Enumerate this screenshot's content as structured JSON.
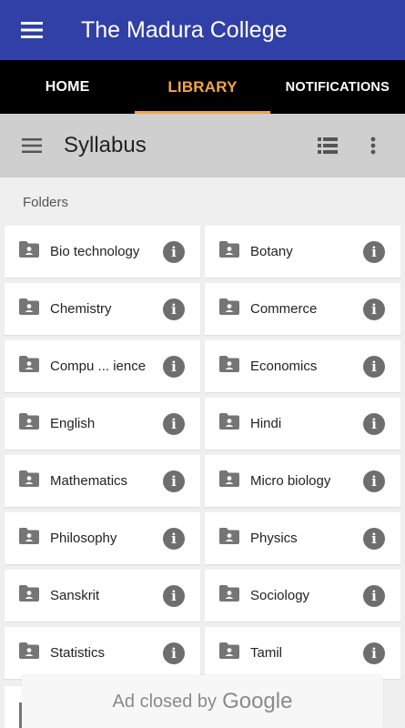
{
  "appbar": {
    "title": "The Madura College",
    "menu_icon": "hamburger-menu-icon"
  },
  "tabs": [
    {
      "label": "HOME",
      "active": false
    },
    {
      "label": "LIBRARY",
      "active": true
    },
    {
      "label": "NOTIFICATIONS",
      "active": false
    }
  ],
  "toolbar": {
    "title": "Syllabus",
    "menu_icon": "hamburger-menu-icon",
    "view_icon": "list-view-icon",
    "more_icon": "more-vert-icon"
  },
  "section": {
    "folders_label": "Folders"
  },
  "folders": [
    "Bio technology",
    "Botany",
    "Chemistry",
    "Commerce",
    "Compu ... ience",
    "Economics",
    "English",
    "Hindi",
    "Mathematics",
    "Micro biology",
    "Philosophy",
    "Physics",
    "Sanskrit",
    "Sociology",
    "Statistics",
    "Tamil"
  ],
  "info_glyph": "i",
  "ad": {
    "text": "Ad closed by",
    "brand": "Google"
  },
  "colors": {
    "appbar": "#3140a7",
    "tabs_bg": "#000000",
    "accent": "#f2a54a",
    "toolbar": "#cfcfcf"
  }
}
